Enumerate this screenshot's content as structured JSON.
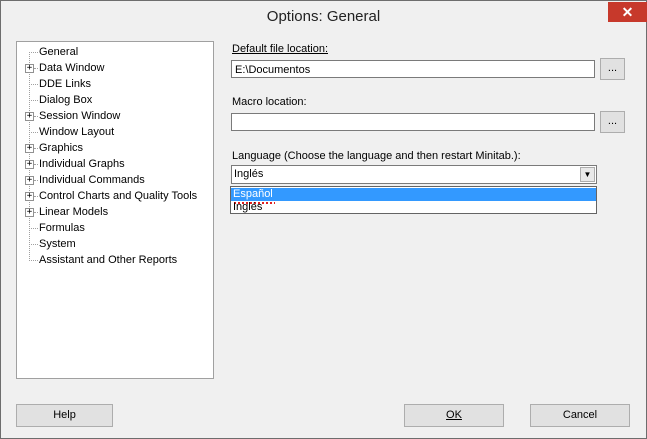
{
  "window": {
    "title": "Options: General",
    "close_label": "✕"
  },
  "tree": {
    "items": [
      {
        "label": "General",
        "expandable": false
      },
      {
        "label": "Data Window",
        "expandable": true
      },
      {
        "label": "DDE Links",
        "expandable": false
      },
      {
        "label": "Dialog Box",
        "expandable": false
      },
      {
        "label": "Session Window",
        "expandable": true
      },
      {
        "label": "Window Layout",
        "expandable": false
      },
      {
        "label": "Graphics",
        "expandable": true
      },
      {
        "label": "Individual Graphs",
        "expandable": true
      },
      {
        "label": "Individual Commands",
        "expandable": true
      },
      {
        "label": "Control Charts and Quality Tools",
        "expandable": true
      },
      {
        "label": "Linear Models",
        "expandable": true
      },
      {
        "label": "Formulas",
        "expandable": false
      },
      {
        "label": "System",
        "expandable": false
      },
      {
        "label": "Assistant and Other Reports",
        "expandable": false
      }
    ]
  },
  "default_file": {
    "label": "Default file location:",
    "value": "E:\\Documentos",
    "browse": "..."
  },
  "macro": {
    "label": "Macro location:",
    "value": "",
    "browse": "..."
  },
  "language": {
    "label": "Language (Choose the language and then restart Minitab.):",
    "selected": "Inglés",
    "options": [
      "Español",
      "Inglés"
    ],
    "highlighted": "Español"
  },
  "buttons": {
    "help": "Help",
    "ok": "OK",
    "cancel": "Cancel"
  },
  "colors": {
    "highlight": "#3399ff",
    "close": "#c7392b"
  }
}
